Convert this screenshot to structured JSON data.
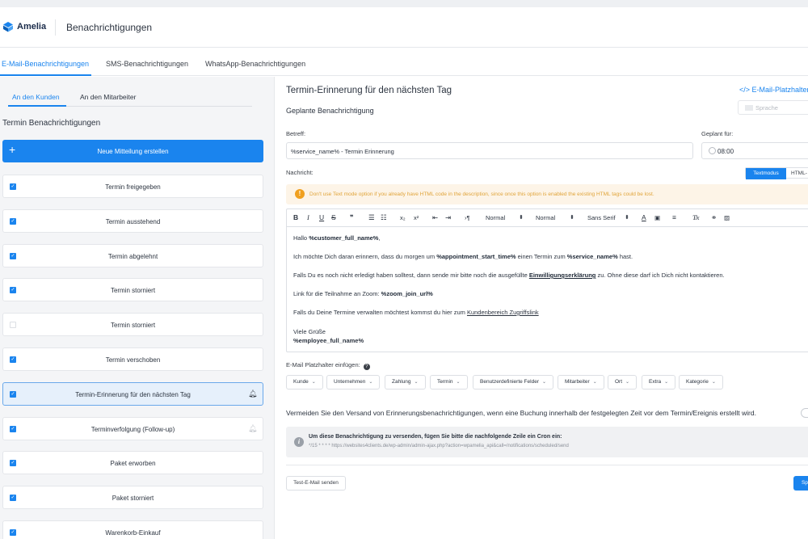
{
  "app": {
    "logo_text": "Amelia",
    "page_title": "Benachrichtigungen",
    "brand_color": "#1a84ee"
  },
  "tabs": [
    {
      "label": "E-Mail-Benachrichtigungen",
      "active": true
    },
    {
      "label": "SMS-Benachrichtigungen",
      "active": false
    },
    {
      "label": "WhatsApp-Benachrichtigungen",
      "active": false
    }
  ],
  "sidebar": {
    "subtabs": [
      {
        "label": "An den Kunden",
        "active": true
      },
      {
        "label": "An den Mitarbeiter",
        "active": false
      }
    ],
    "section_title": "Termin Benachrichtigungen",
    "new_button": "Neue Mitteilung erstellen",
    "items": [
      {
        "label": "Termin freigegeben",
        "checked": true,
        "selected": false,
        "icon": ""
      },
      {
        "label": "Termin ausstehend",
        "checked": true,
        "selected": false,
        "icon": ""
      },
      {
        "label": "Termin abgelehnt",
        "checked": true,
        "selected": false,
        "icon": ""
      },
      {
        "label": "Termin storniert",
        "checked": true,
        "selected": false,
        "icon": ""
      },
      {
        "label": "Termin storniert",
        "checked": false,
        "selected": false,
        "icon": ""
      },
      {
        "label": "Termin verschoben",
        "checked": true,
        "selected": false,
        "icon": ""
      },
      {
        "label": "Termin-Erinnerung für den nächsten Tag",
        "checked": true,
        "selected": true,
        "icon": "bell-icon"
      },
      {
        "label": "Terminverfolgung (Follow-up)",
        "checked": true,
        "selected": false,
        "icon": "bell-icon-faint"
      },
      {
        "label": "Paket erworben",
        "checked": true,
        "selected": false,
        "icon": ""
      },
      {
        "label": "Paket storniert",
        "checked": true,
        "selected": false,
        "icon": ""
      },
      {
        "label": "Warenkorb-Einkauf",
        "checked": true,
        "selected": false,
        "icon": ""
      }
    ]
  },
  "main": {
    "title": "Termin-Erinnerung für den nächsten Tag",
    "subtitle": "Geplante Benachrichtigung",
    "placeholders_link": "</> E-Mail-Platzhalter",
    "language_placeholder": "Sprache",
    "subject_label": "Betreff:",
    "subject_value": "%service_name% - Termin Erinnerung",
    "scheduled_label": "Geplant für:",
    "scheduled_value": "08:00",
    "message_label": "Nachricht:",
    "mode_text": "Textmodus",
    "mode_html": "HTML-",
    "warning": "Don't use Text mode option if you already have HTML code in the description, since once this option is enabled the existing HTML tags could be lost.",
    "toolbar": {
      "bold": "B",
      "italic": "I",
      "underline": "U",
      "strike": "S",
      "quote": "❞",
      "sub": "x₂",
      "sup": "x²",
      "pilcrow": "›¶",
      "select1": "Normal",
      "select2": "Normal",
      "font": "Sans Serif",
      "clear": "T̸x"
    },
    "body": {
      "l1_pre": "Hallo ",
      "l1_b": "%customer_full_name%",
      "l1_post": ",",
      "l2_pre": "Ich möchte Dich daran erinnern, dass du morgen um ",
      "l2_b1": "%appointment_start_time%",
      "l2_mid": " einen Termin zum ",
      "l2_b2": "%service_name%",
      "l2_post": " hast.",
      "l3_pre": "Falls Du es noch nicht erledigt haben solltest, dann sende mir bitte noch die ausgefüllte ",
      "l3_link": "Einwilligungserklärung",
      "l3_post": " zu. Ohne diese darf ich Dich nicht kontaktieren.",
      "l4_pre": "Link für die Teilnahme an Zoom: ",
      "l4_b": "%zoom_join_url%",
      "l5_pre": "Falls du Deine Termine verwalten möchtest kommst du hier zum ",
      "l5_link": "Kundenbereich Zugriffslink",
      "l6": "Viele Grüße",
      "l7": "%employee_full_name%"
    },
    "placeholder_title": "E-Mail Platzhalter einfügen:",
    "placeholder_help": "?",
    "chips": [
      "Kunde",
      "Unternehmen",
      "Zahlung",
      "Termin",
      "Benutzerdefinierte Felder",
      "Mitarbeiter",
      "Ort",
      "Extra",
      "Kategorie"
    ],
    "avoid_text": "Vermeiden Sie den Versand von Erinnerungsbenachrichtigungen, wenn eine Buchung innerhalb der festgelegten Zeit vor dem Termin/Ereignis erstellt wird.",
    "info_icon": "i",
    "info_title": "Um diese Benachrichtigung zu versenden, fügen Sie bitte die nachfolgende Zeile ein Cron ein:",
    "info_cron": "*/15 * * * * https://websites4clients.de/wp-admin/admin-ajax.php?action=wpamelia_api&call=/notifications/scheduled/send",
    "test_button": "Test-E-Mail senden",
    "save_button": "Sp"
  }
}
